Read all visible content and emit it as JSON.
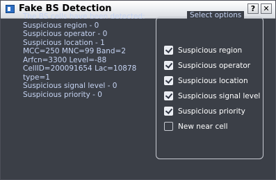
{
  "window": {
    "title": "Fake BS Detection",
    "help_label": "?",
    "close_label": "✕"
  },
  "icons": {
    "app": "app-window-icon",
    "check": "checkmark-icon"
  },
  "colors": {
    "background": "#3b3f47",
    "info_text": "#c5d3f2",
    "option_text": "#ffffff"
  },
  "info": {
    "lines": [
      "The BS cells have been detected:",
      "Suspicious region - 0",
      "Suspicious operator - 0",
      "Suspicious location - 1",
      "MCC=250  MNC=99  Band=2",
      "Arfcn=3300  Level=-88",
      "CellID=200091654  Lac=10878",
      "type=1",
      "Suspicious signal level - 0",
      "Suspicious priority - 0"
    ]
  },
  "options": {
    "legend": "Select options",
    "items": [
      {
        "label": "Suspicious region",
        "checked": true
      },
      {
        "label": "Suspicious operator",
        "checked": true
      },
      {
        "label": "Suspicious location",
        "checked": true
      },
      {
        "label": "Suspicious signal level",
        "checked": true
      },
      {
        "label": "Suspicious priority",
        "checked": true
      },
      {
        "label": "New near cell",
        "checked": false
      }
    ]
  }
}
